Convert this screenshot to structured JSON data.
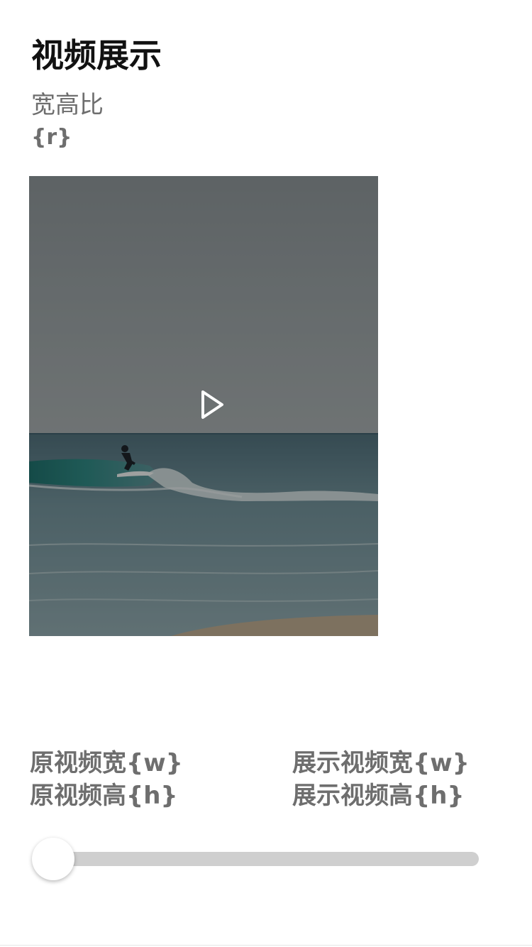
{
  "page": {
    "title": "视频展示",
    "ratio_label": "宽高比",
    "ratio_value": "{r}"
  },
  "video": {
    "play_icon": "play-icon",
    "scene": "surfer on ocean wave, dimmed overlay"
  },
  "stats": {
    "original_width": "原视频宽{w}",
    "original_height": "原视频高{h}",
    "display_width": "展示视频宽{w}",
    "display_height": "展示视频高{h}"
  },
  "slider": {
    "value": 0
  },
  "colors": {
    "title": "#111111",
    "secondary_text": "#6e6e6e",
    "slider_track": "#cfcfcf",
    "overlay": "#000000"
  }
}
